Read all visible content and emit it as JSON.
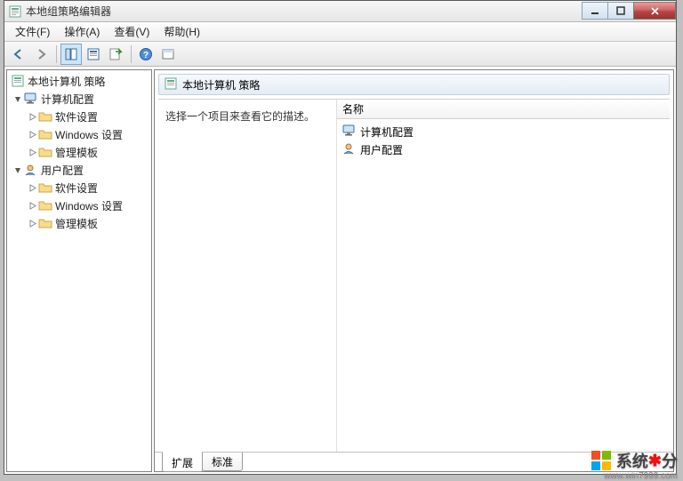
{
  "window": {
    "title": "本地组策略编辑器"
  },
  "menubar": {
    "file": "文件(F)",
    "action": "操作(A)",
    "view": "查看(V)",
    "help": "帮助(H)"
  },
  "tree": {
    "root": "本地计算机 策略",
    "computer_config": "计算机配置",
    "computer_children": {
      "software": "软件设置",
      "windows": "Windows 设置",
      "admin_templates": "管理模板"
    },
    "user_config": "用户配置",
    "user_children": {
      "software": "软件设置",
      "windows": "Windows 设置",
      "admin_templates": "管理模板"
    }
  },
  "right": {
    "header_title": "本地计算机 策略",
    "description_placeholder": "选择一个项目来查看它的描述。",
    "column_name": "名称",
    "items": {
      "computer": "计算机配置",
      "user": "用户配置"
    },
    "tabs": {
      "extended": "扩展",
      "standard": "标准"
    }
  },
  "watermark": {
    "brand_a": "系统",
    "brand_b": "分",
    "url": "www.win7999.com"
  }
}
